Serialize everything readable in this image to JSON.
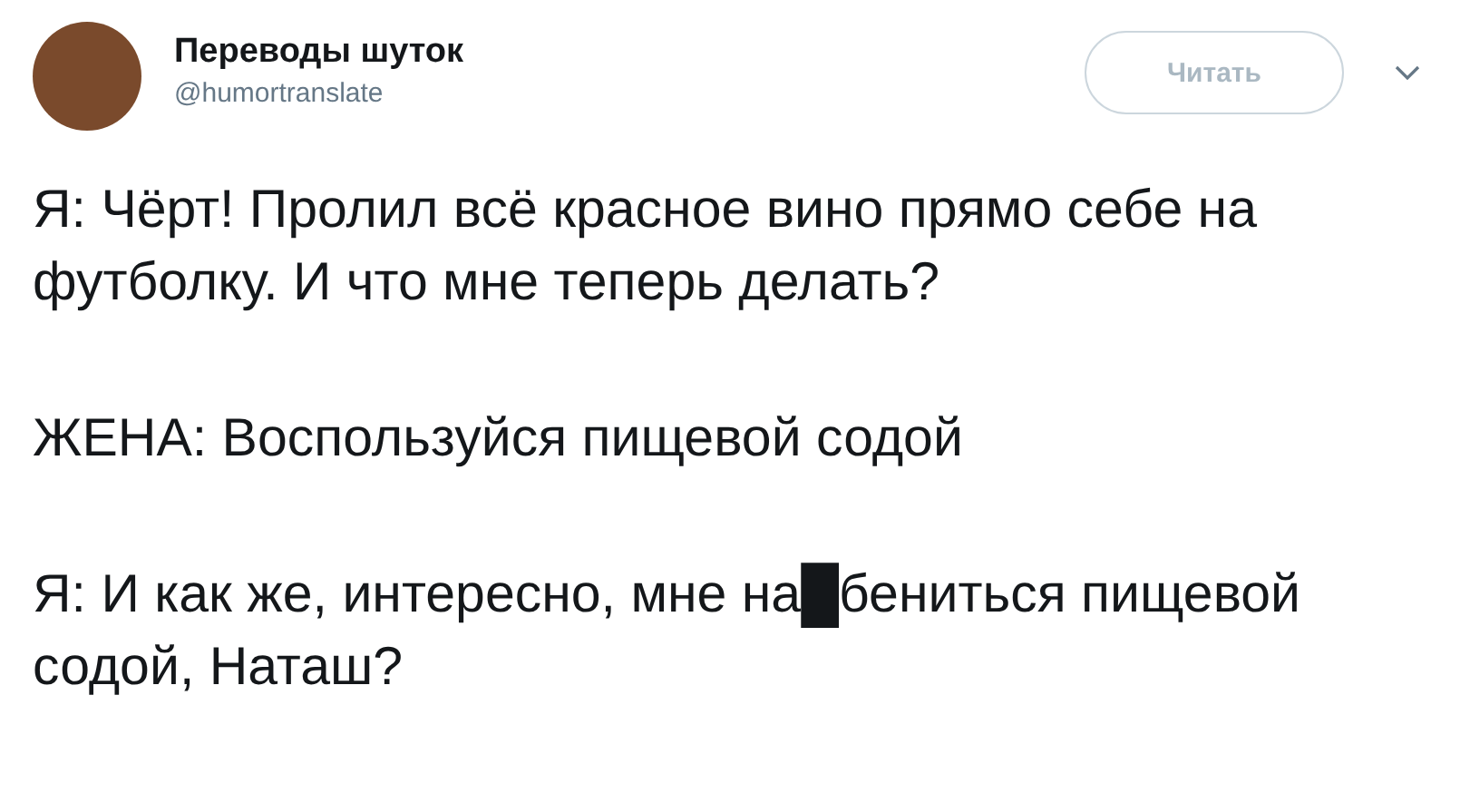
{
  "account": {
    "name": "Переводы шуток",
    "handle": "@humortranslate"
  },
  "follow_button": {
    "label": "Читать"
  },
  "paragraphs": [
    "Я: Чёрт! Пролил всё красное вино прямо себе на футболку. И что мне теперь делать?",
    "ЖЕНА: Воспользуйся пищевой содой",
    "Я: И как же, интересно, мне на█бениться пищевой содой, Наташ?"
  ]
}
